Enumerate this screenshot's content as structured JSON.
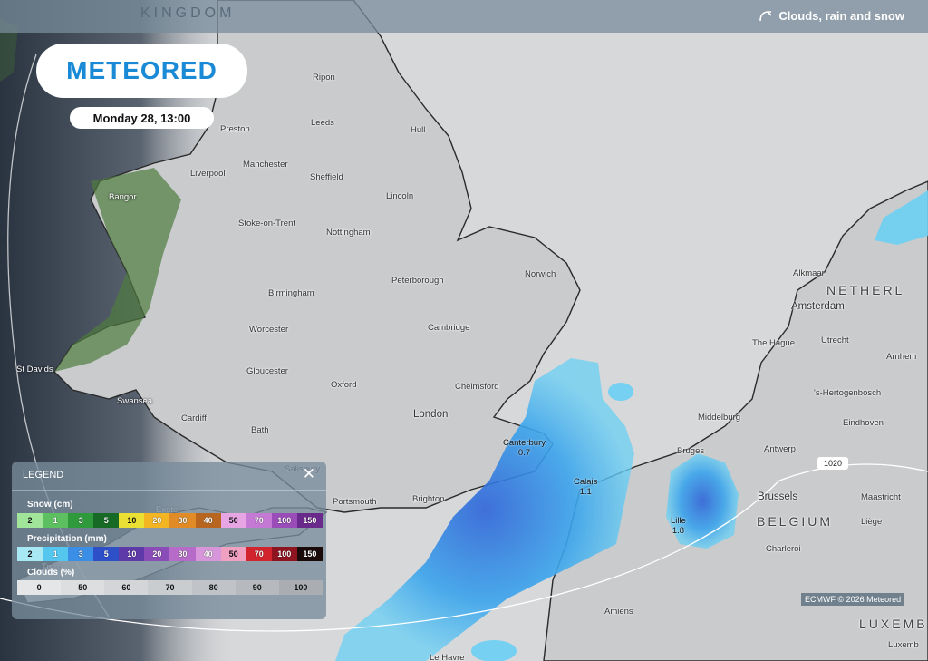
{
  "header": {
    "country_fragment": "KINGDOM",
    "layer_label": "Clouds, rain and snow",
    "layer_icon": "cloud-rain-icon"
  },
  "brand": {
    "logo": "METEORED"
  },
  "forecast_time": "Monday 28, 13:00",
  "legend": {
    "title": "LEGEND",
    "close_icon": "close-icon",
    "snow": {
      "label": "Snow (cm)",
      "values": [
        "2",
        "1",
        "3",
        "5",
        "10",
        "20",
        "30",
        "40",
        "50",
        "70",
        "100",
        "150"
      ],
      "colors": [
        "#a0e59a",
        "#5cc060",
        "#2f9a3c",
        "#166a26",
        "#e9e033",
        "#f4b523",
        "#e08b25",
        "#b8661f",
        "#e7a6e3",
        "#c47ad4",
        "#9a4cb8",
        "#6a2a8c"
      ]
    },
    "precipitation": {
      "label": "Precipitation (mm)",
      "values": [
        "2",
        "1",
        "3",
        "5",
        "10",
        "20",
        "30",
        "40",
        "50",
        "70",
        "100",
        "150"
      ],
      "colors": [
        "#a8e7f4",
        "#55c6ee",
        "#3a8ee6",
        "#2d4fc8",
        "#5e3aa8",
        "#8a4cb6",
        "#b66bc8",
        "#d696d9",
        "#f0a0c0",
        "#d2242c",
        "#8e1420",
        "#1a0a0a"
      ]
    },
    "clouds": {
      "label": "Clouds (%)",
      "values": [
        "0",
        "50",
        "60",
        "70",
        "80",
        "90",
        "100"
      ],
      "colors": [
        "#e4e6e8",
        "#dcdee0",
        "#d3d5d8",
        "#cacdd0",
        "#c0c3c7",
        "#b6b9bd",
        "#aaaeb3"
      ]
    }
  },
  "places": [
    {
      "name": "Ripon"
    },
    {
      "name": "Preston"
    },
    {
      "name": "Leeds"
    },
    {
      "name": "Hull"
    },
    {
      "name": "Manchester"
    },
    {
      "name": "Liverpool"
    },
    {
      "name": "Sheffield"
    },
    {
      "name": "Bangor"
    },
    {
      "name": "Lincoln"
    },
    {
      "name": "Stoke-on-Trent"
    },
    {
      "name": "Nottingham"
    },
    {
      "name": "Norwich"
    },
    {
      "name": "Peterborough"
    },
    {
      "name": "Birmingham"
    },
    {
      "name": "Cambridge"
    },
    {
      "name": "Worcester"
    },
    {
      "name": "St Davids"
    },
    {
      "name": "Gloucester"
    },
    {
      "name": "Oxford"
    },
    {
      "name": "Chelmsford"
    },
    {
      "name": "Swansea"
    },
    {
      "name": "Cardiff"
    },
    {
      "name": "London"
    },
    {
      "name": "Bath"
    },
    {
      "name": "Salisbury"
    },
    {
      "name": "Portsmouth"
    },
    {
      "name": "Brighton"
    },
    {
      "name": "Exeter"
    },
    {
      "name": "Truro"
    },
    {
      "name": "Amiens"
    },
    {
      "name": "Le Havre"
    },
    {
      "name": "Bruges"
    },
    {
      "name": "Antwerp"
    },
    {
      "name": "Middelburg"
    },
    {
      "name": "Brussels"
    },
    {
      "name": "Maastricht"
    },
    {
      "name": "Liège"
    },
    {
      "name": "Charleroi"
    },
    {
      "name": "Alkmaar"
    },
    {
      "name": "Amsterdam"
    },
    {
      "name": "The Hague"
    },
    {
      "name": "Utrecht"
    },
    {
      "name": "Arnhem"
    },
    {
      "name": "'s-Hertogenbosch"
    },
    {
      "name": "Eindhoven"
    },
    {
      "name": "Luxemb"
    }
  ],
  "countries": [
    {
      "name": "NETHERL"
    },
    {
      "name": "BELGIUM"
    },
    {
      "name": "LUXEMB"
    }
  ],
  "precip_readings": [
    {
      "place": "Canterbury",
      "value": "0.7"
    },
    {
      "place": "Calais",
      "value": "1.1"
    },
    {
      "place": "Lille",
      "value": "1.8"
    }
  ],
  "isobar": "1020",
  "credit": "ECMWF © 2026 Meteored"
}
